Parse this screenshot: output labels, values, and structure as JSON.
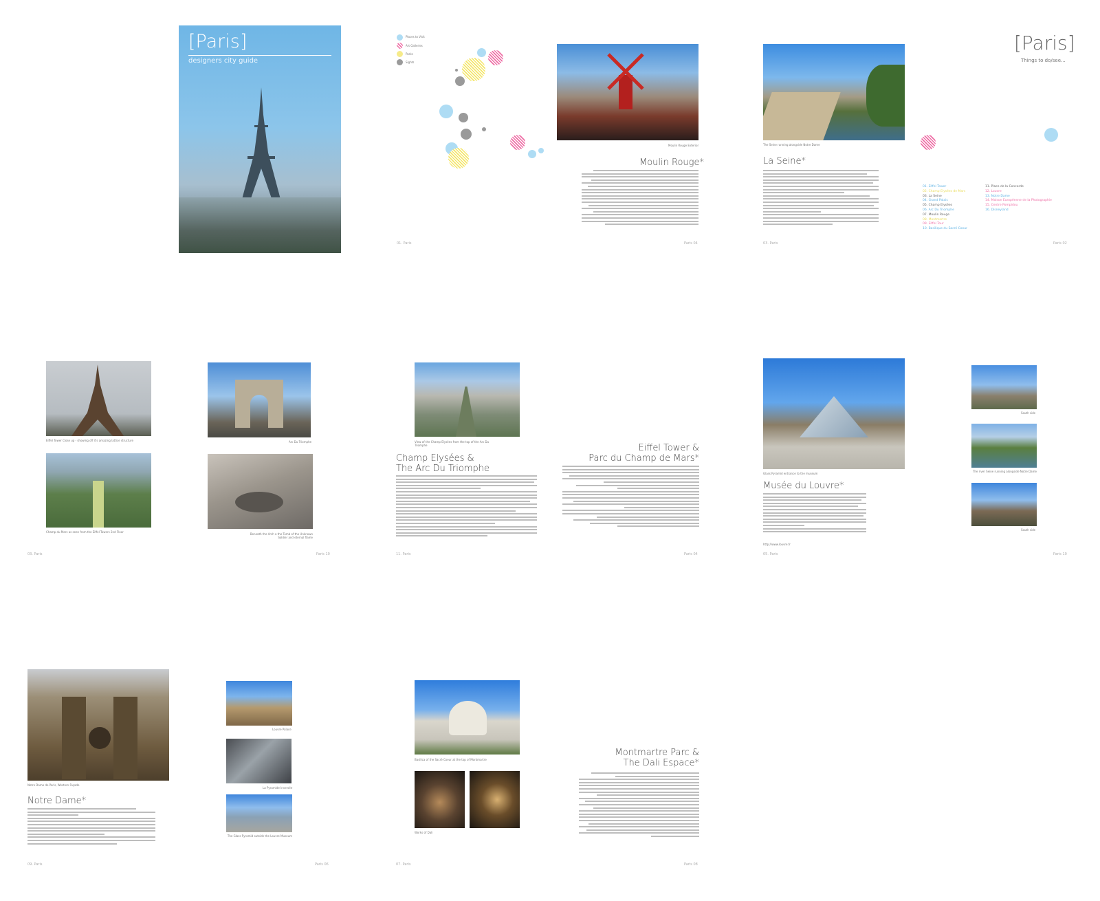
{
  "cover": {
    "title": "[Paris]",
    "subtitle": "designers city guide"
  },
  "spread1": {
    "legend": [
      "Places to Visit",
      "Art Galleries",
      "Parks",
      "Sights"
    ],
    "photo_caption": "Moulin Rouge Exterior",
    "heading": "Moulin Rouge*",
    "folio_left": "01. Paris",
    "folio_right": "Paris 04"
  },
  "spread2": {
    "photo_caption": "The Seine running alongside Notre Dame",
    "heading": "La Seine*",
    "title": "[Paris]",
    "subtitle": "Things to do/see...",
    "toc_left": [
      "01. Eiffel Tower",
      "02. Champ Elysées de Mars",
      "03. La Seine",
      "04. Grand Palais",
      "05. Champ Elysées",
      "06. Arc Du Triomphe",
      "07. Moulin Rouge",
      "08. Montmartre",
      "09. Eiffel Tour",
      "10. Basilique du Sacré Coeur"
    ],
    "toc_right": [
      "11. Place de la Concorde",
      "12. Louvre",
      "13. Notre Dame",
      "14. Maison Européenne de la Photographie",
      "15. Centre Pompidou",
      "16. Disneyland"
    ],
    "folio_left": "03. Paris",
    "folio_right": "Paris 02"
  },
  "spread3": {
    "captions": [
      "Eiffel Tower Close up - showing off it's amazing lattice structure",
      "Arc Du Triomphe",
      "Champ du Mars as seen from the Eiffel Towers 2nd Floor",
      "Beneath the Arch a the Tomb of the Unknown Soldier and eternal flame"
    ],
    "folio_left": "03. Paris",
    "folio_right": "Paris 10"
  },
  "spread4": {
    "photo_caption": "View of the Champ Elysées from the top of the Arc Du Triomphe",
    "heading_left": [
      "Champ Elysées &",
      "The Arc Du Triomphe"
    ],
    "heading_right": [
      "Eiffel Tower &",
      "Parc du Champ de Mars*"
    ],
    "folio_left": "11. Paris",
    "folio_right": "Paris 04"
  },
  "spread5": {
    "photo_caption": "Glass Pyramid entrance to the museum",
    "heading": "Musée du Louvre*",
    "url": "http://www.louvre.fr",
    "captions": [
      "South side",
      "The river Seine running alongside Notre Dame",
      "South side"
    ],
    "folio_left": "05. Paris",
    "folio_right": "Paris 10"
  },
  "spread6": {
    "photo_caption": "Notre Dame de Paris, Western Façade",
    "heading": "Notre Dame*",
    "captions": [
      "Louvre Palace",
      "La Pyramide Inversée",
      "The Glass Pyramid outside the Louvre Museum"
    ],
    "folio_left": "09. Paris",
    "folio_right": "Paris 06"
  },
  "spread7": {
    "photo_caption": "Basilica of the Sacré Coeur at the top of Montmartre",
    "caption2": "Works of Dali",
    "heading": [
      "Montmartre Parc &",
      "The Dali Espace*"
    ],
    "folio_left": "07. Paris",
    "folio_right": "Paris 08"
  }
}
